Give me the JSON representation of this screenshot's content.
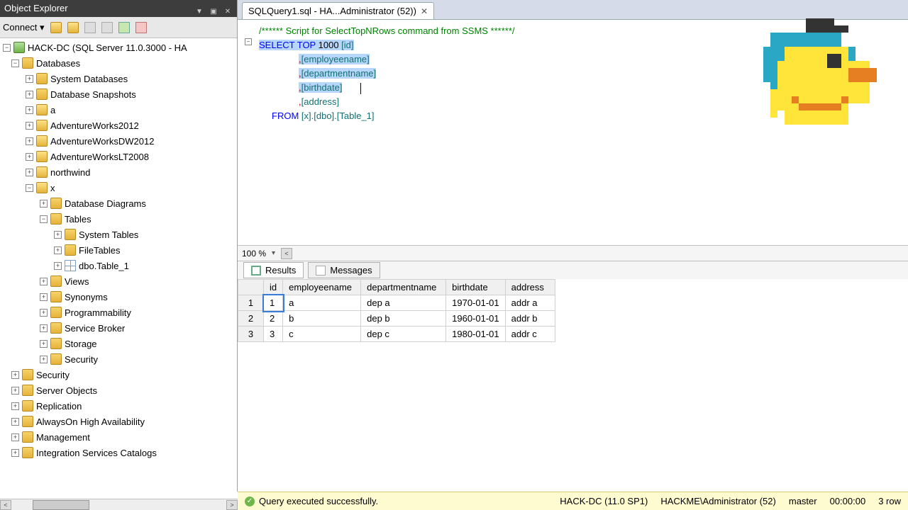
{
  "explorer": {
    "title": "Object Explorer",
    "connect_label": "Connect ▾",
    "root": "HACK-DC (SQL Server 11.0.3000 - HA",
    "nodes": {
      "databases": "Databases",
      "system_db": "System Databases",
      "db_snapshots": "Database Snapshots",
      "a": "a",
      "aw2012": "AdventureWorks2012",
      "awdw2012": "AdventureWorksDW2012",
      "awlt2008": "AdventureWorksLT2008",
      "northwind": "northwind",
      "x": "x",
      "db_diagrams": "Database Diagrams",
      "tables": "Tables",
      "system_tables": "System Tables",
      "filetables": "FileTables",
      "dbo_table1": "dbo.Table_1",
      "views": "Views",
      "synonyms": "Synonyms",
      "programmability": "Programmability",
      "service_broker": "Service Broker",
      "storage": "Storage",
      "security_inner": "Security",
      "security": "Security",
      "server_objects": "Server Objects",
      "replication": "Replication",
      "alwayson": "AlwaysOn High Availability",
      "management": "Management",
      "isc": "Integration Services Catalogs"
    }
  },
  "tab": {
    "title": "SQLQuery1.sql - HA...Administrator (52))"
  },
  "sql": {
    "comment": "/****** Script for SelectTopNRows command from SSMS  ******/",
    "select": "SELECT",
    "top": "TOP",
    "topn": "1000",
    "c_id": "[id]",
    "c_emp": "[employeename]",
    "c_dep": "[departmentname]",
    "c_birth": "[birthdate]",
    "c_addr": "[address]",
    "from": "FROM",
    "tbl": "[x].[dbo].[Table_1]"
  },
  "zoom": "100 %",
  "results": {
    "tab_results": "Results",
    "tab_messages": "Messages",
    "columns": [
      "",
      "id",
      "employeename",
      "departmentname",
      "birthdate",
      "address"
    ],
    "rows": [
      {
        "n": "1",
        "id": "1",
        "emp": "a",
        "dep": "dep a",
        "birth": "1970-01-01",
        "addr": "addr a"
      },
      {
        "n": "2",
        "id": "2",
        "emp": "b",
        "dep": "dep b",
        "birth": "1960-01-01",
        "addr": "addr b"
      },
      {
        "n": "3",
        "id": "3",
        "emp": "c",
        "dep": "dep c",
        "birth": "1980-01-01",
        "addr": "addr c"
      }
    ]
  },
  "status": {
    "msg": "Query executed successfully.",
    "server": "HACK-DC (11.0 SP1)",
    "user": "HACKME\\Administrator (52)",
    "db": "master",
    "time": "00:00:00",
    "rows": "3 row"
  }
}
